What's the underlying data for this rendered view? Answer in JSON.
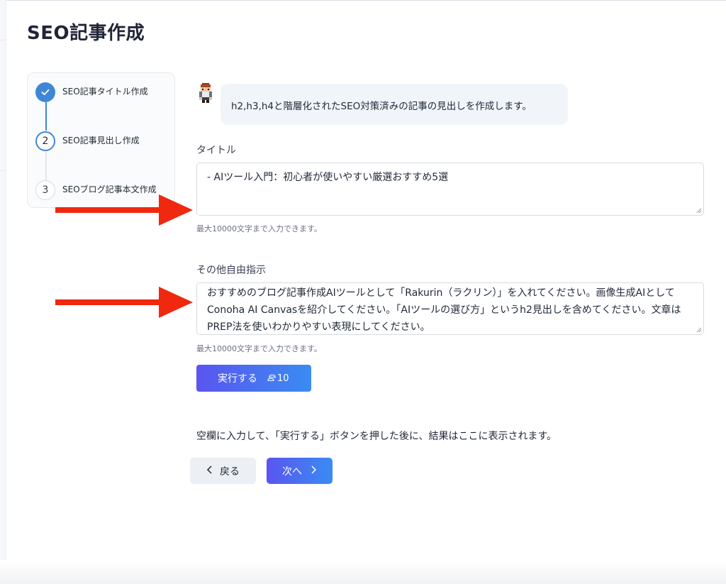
{
  "page": {
    "title": "SEO記事作成"
  },
  "stepper": {
    "steps": [
      {
        "number": "",
        "label": "SEO記事タイトル作成",
        "status": "completed"
      },
      {
        "number": "2",
        "label": "SEO記事見出し作成",
        "status": "active"
      },
      {
        "number": "3",
        "label": "SEOブログ記事本文作成",
        "status": "pending"
      }
    ]
  },
  "assistant": {
    "message": "h2,h3,h4と階層化されたSEO対策済みの記事の見出しを作成します。"
  },
  "form": {
    "title_label": "タイトル",
    "title_value": "- AIツール入門：初心者が使いやすい厳選おすすめ5選",
    "title_hint": "最大10000文字まで入力できます。",
    "instructions_label": "その他自由指示",
    "instructions_value": "おすすめのブログ記事作成AIツールとして「Rakurin（ラクリン）」を入れてください。画像生成AIとしてConoha AI Canvasを紹介してください。「AIツールの選び方」というh2見出しを含めてください。文章はPREP法を使いわかりやすい表現にしてください。",
    "instructions_hint": "最大10000文字まで入力できます。"
  },
  "run_button": {
    "label": "実行する",
    "cost": "10"
  },
  "result": {
    "placeholder": "空欄に入力して、「実行する」ボタンを押した後に、結果はここに表示されます。"
  },
  "navigation": {
    "back_label": "戻る",
    "next_label": "次へ"
  },
  "colors": {
    "accent": "#3f87d6",
    "button_gradient_start": "#5a55f0",
    "button_gradient_end": "#3a8cf2",
    "annotation_arrow": "#f0280f"
  }
}
